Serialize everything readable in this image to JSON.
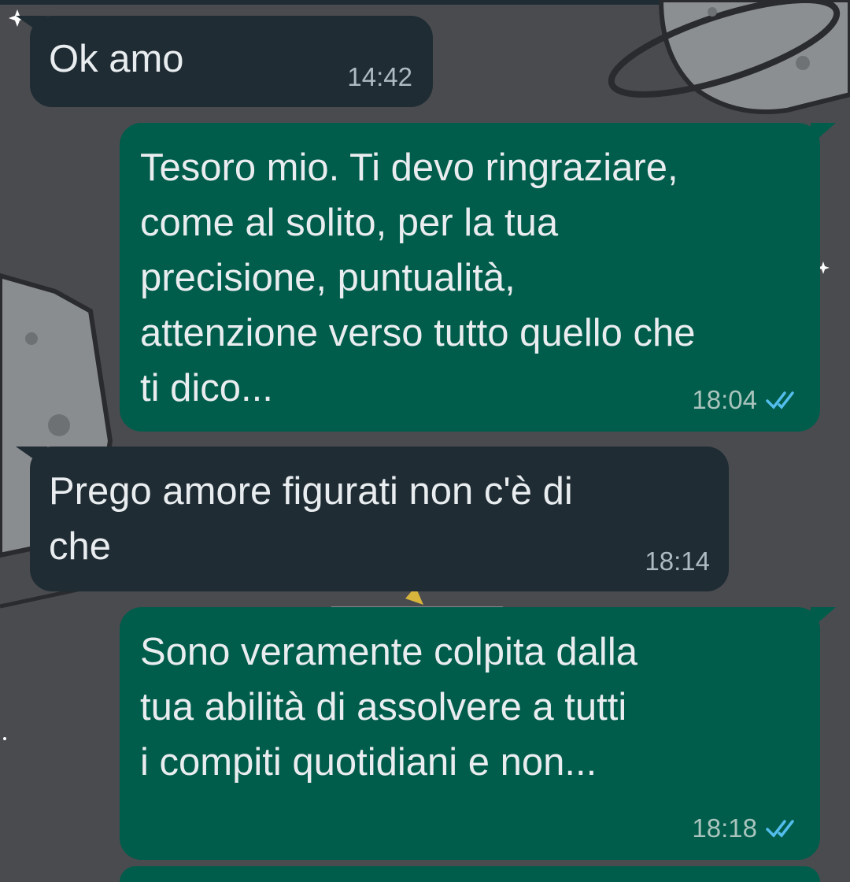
{
  "theme": {
    "incoming_bubble": "#1f2c34",
    "outgoing_bubble": "#005c4b",
    "text_color": "#e9edef",
    "read_ticks_color": "#53bdeb",
    "wallpaper": "#4a4b4f"
  },
  "messages": [
    {
      "direction": "incoming",
      "text": "Ok amo",
      "time": "14:42"
    },
    {
      "direction": "outgoing",
      "text": "Tesoro mio. Ti devo ringraziare,\ncome al solito, per la tua\nprecisione, puntualità,\nattenzione verso tutto quello che\nti dico...",
      "time": "18:04",
      "status": "read",
      "status_icon": "double-check-icon"
    },
    {
      "direction": "incoming",
      "text": "Prego amore figurati non c'è di\nche",
      "time": "18:14"
    },
    {
      "direction": "outgoing",
      "text": "Sono veramente colpita dalla\ntua abilità di assolvere a tutti\ni compiti quotidiani e non...",
      "time": "18:18",
      "status": "read",
      "status_icon": "double-check-icon"
    }
  ]
}
